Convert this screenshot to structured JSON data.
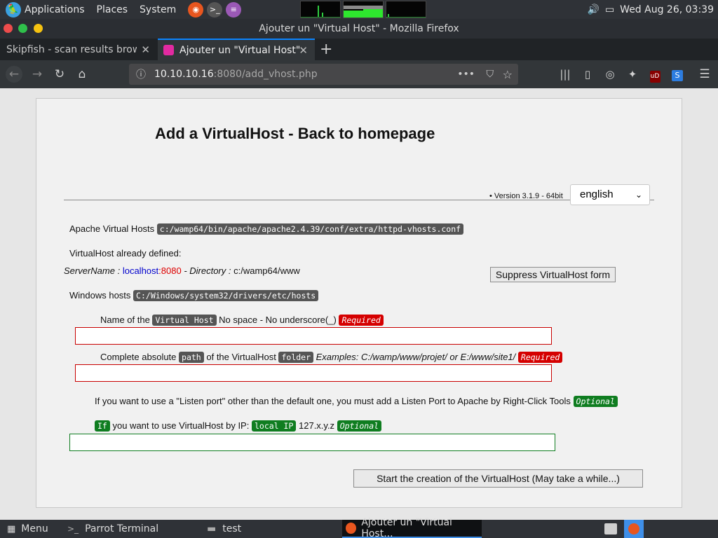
{
  "top_panel": {
    "menus": [
      "Applications",
      "Places",
      "System"
    ],
    "clock": "Wed Aug 26, 03:39"
  },
  "window": {
    "title": "Ajouter un \"Virtual Host\" - Mozilla Firefox"
  },
  "tabs": [
    {
      "label": "Skipfish - scan results brows",
      "active": false
    },
    {
      "label": "Ajouter un \"Virtual Host\"",
      "active": true
    }
  ],
  "urlbar": {
    "host": "10.10.10.16",
    "rest": ":8080/add_vhost.php"
  },
  "page": {
    "heading": "Add a VirtualHost - Back to homepage",
    "version": "Version 3.1.9 - 64bit",
    "language": "english",
    "apache_label": "Apache Virtual Hosts",
    "apache_path": "c:/wamp64/bin/apache/apache2.4.39/conf/extra/httpd-vhosts.conf",
    "already_defined": "VirtualHost already defined:",
    "server_name_label": "ServerName :",
    "server_host": "localhost",
    "server_port": ":8080",
    "directory_label": "- Directory :",
    "directory_value": "c:/wamp64/www",
    "suppress_button": "Suppress VirtualHost form",
    "windows_hosts_label": "Windows hosts",
    "windows_hosts_path": "C:/Windows/system32/drivers/etc/hosts",
    "name_label_1": "Name of the",
    "name_code": "Virtual Host",
    "name_label_2": "No space - No underscore(_)",
    "required": "Required",
    "path_label_1": "Complete absolute",
    "path_code": "path",
    "path_label_2": "of the VirtualHost",
    "path_code_2": "folder",
    "path_examples": "Examples: C:/wamp/www/projet/ or E:/www/site1/",
    "listen_text": "If you want to use a \"Listen port\" other than the default one, you must add a Listen Port to Apache by Right-Click Tools",
    "optional": "Optional",
    "ip_if": "If",
    "ip_text": "you want to use VirtualHost by IP:",
    "ip_code": "local IP",
    "ip_value": "127.x.y.z",
    "submit_button": "Start the creation of the VirtualHost (May take a while...)"
  },
  "taskbar": {
    "menu": "Menu",
    "terminal": "Parrot Terminal",
    "folder": "test",
    "firefox": "Ajouter un \"Virtual Host..."
  },
  "colors": {
    "required_red": "#d50000",
    "optional_green": "#0f7d20",
    "accent_blue": "#0a84ff"
  }
}
